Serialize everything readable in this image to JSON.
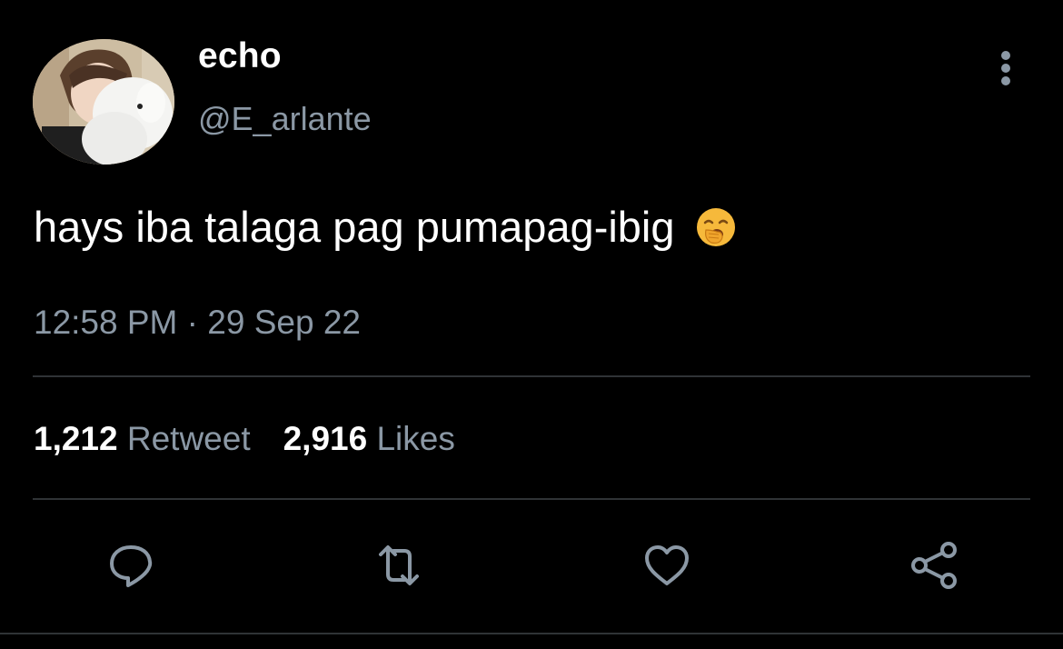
{
  "author": {
    "display_name": "echo",
    "handle": "@E_arlante"
  },
  "tweet": {
    "text": "hays iba talaga pag pumapag-ibig",
    "emoji": "yawning-face-emoji",
    "time": "12:58 PM",
    "separator": "·",
    "date": "29 Sep 22"
  },
  "stats": {
    "retweets_count": "1,212",
    "retweets_label": "Retweet",
    "likes_count": "2,916",
    "likes_label": "Likes"
  },
  "actions": [
    "reply-icon",
    "retweet-icon",
    "like-icon",
    "share-icon"
  ],
  "colors": {
    "background": "#000000",
    "primary_text": "#ffffff",
    "secondary_text": "#8b98a5",
    "divider": "#2f3336",
    "emoji": "#f6b93b"
  }
}
